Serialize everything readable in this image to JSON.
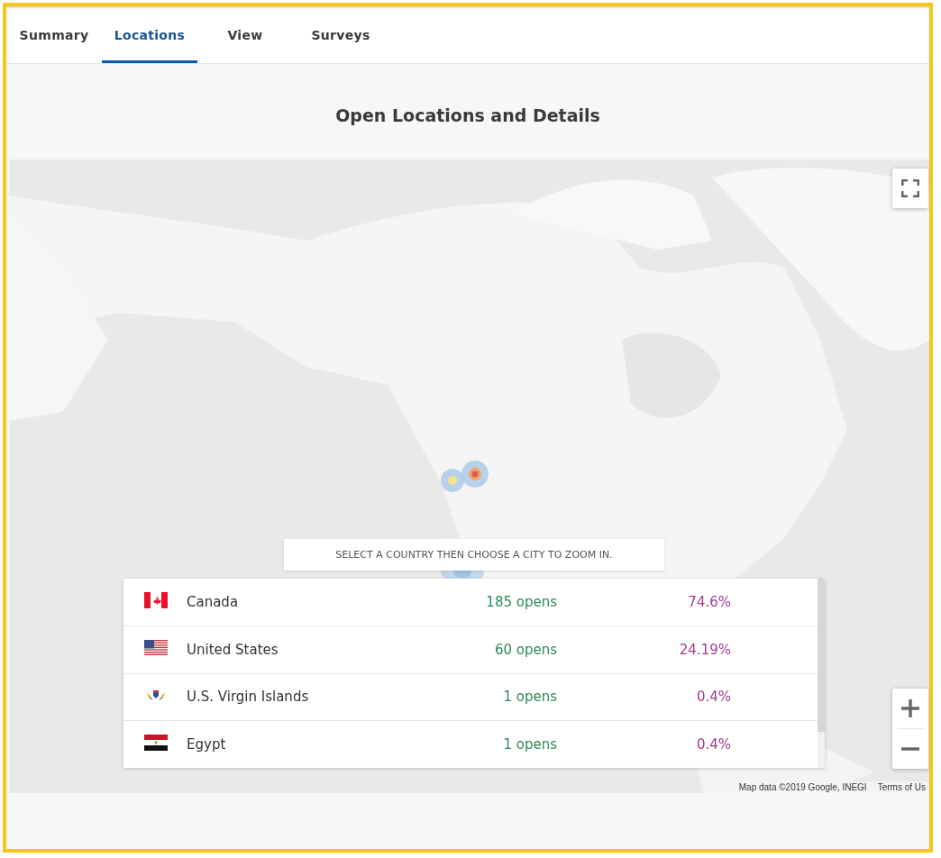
{
  "tabs": [
    {
      "label": "Summary",
      "selected": false
    },
    {
      "label": "Locations",
      "selected": true
    },
    {
      "label": "View",
      "selected": false
    },
    {
      "label": "Surveys",
      "selected": false
    }
  ],
  "title": "Open Locations and Details",
  "map": {
    "hint": "SELECT A COUNTRY THEN CHOOSE A CITY TO ZOOM IN.",
    "countries": [
      {
        "kind": "canada",
        "name": "Canada",
        "opens": "185 opens",
        "share": "74.6%"
      },
      {
        "kind": "usa",
        "name": "United States",
        "opens": "60 opens",
        "share": "24.19%"
      },
      {
        "kind": "usvi",
        "name": "U.S. Virgin Islands",
        "opens": "1 opens",
        "share": "0.4%"
      },
      {
        "kind": "egypt",
        "name": "Egypt",
        "opens": "1 opens",
        "share": "0.4%"
      }
    ],
    "attribution": "Map data ©2019 Google, INEGI",
    "terms": "Terms of Us"
  }
}
